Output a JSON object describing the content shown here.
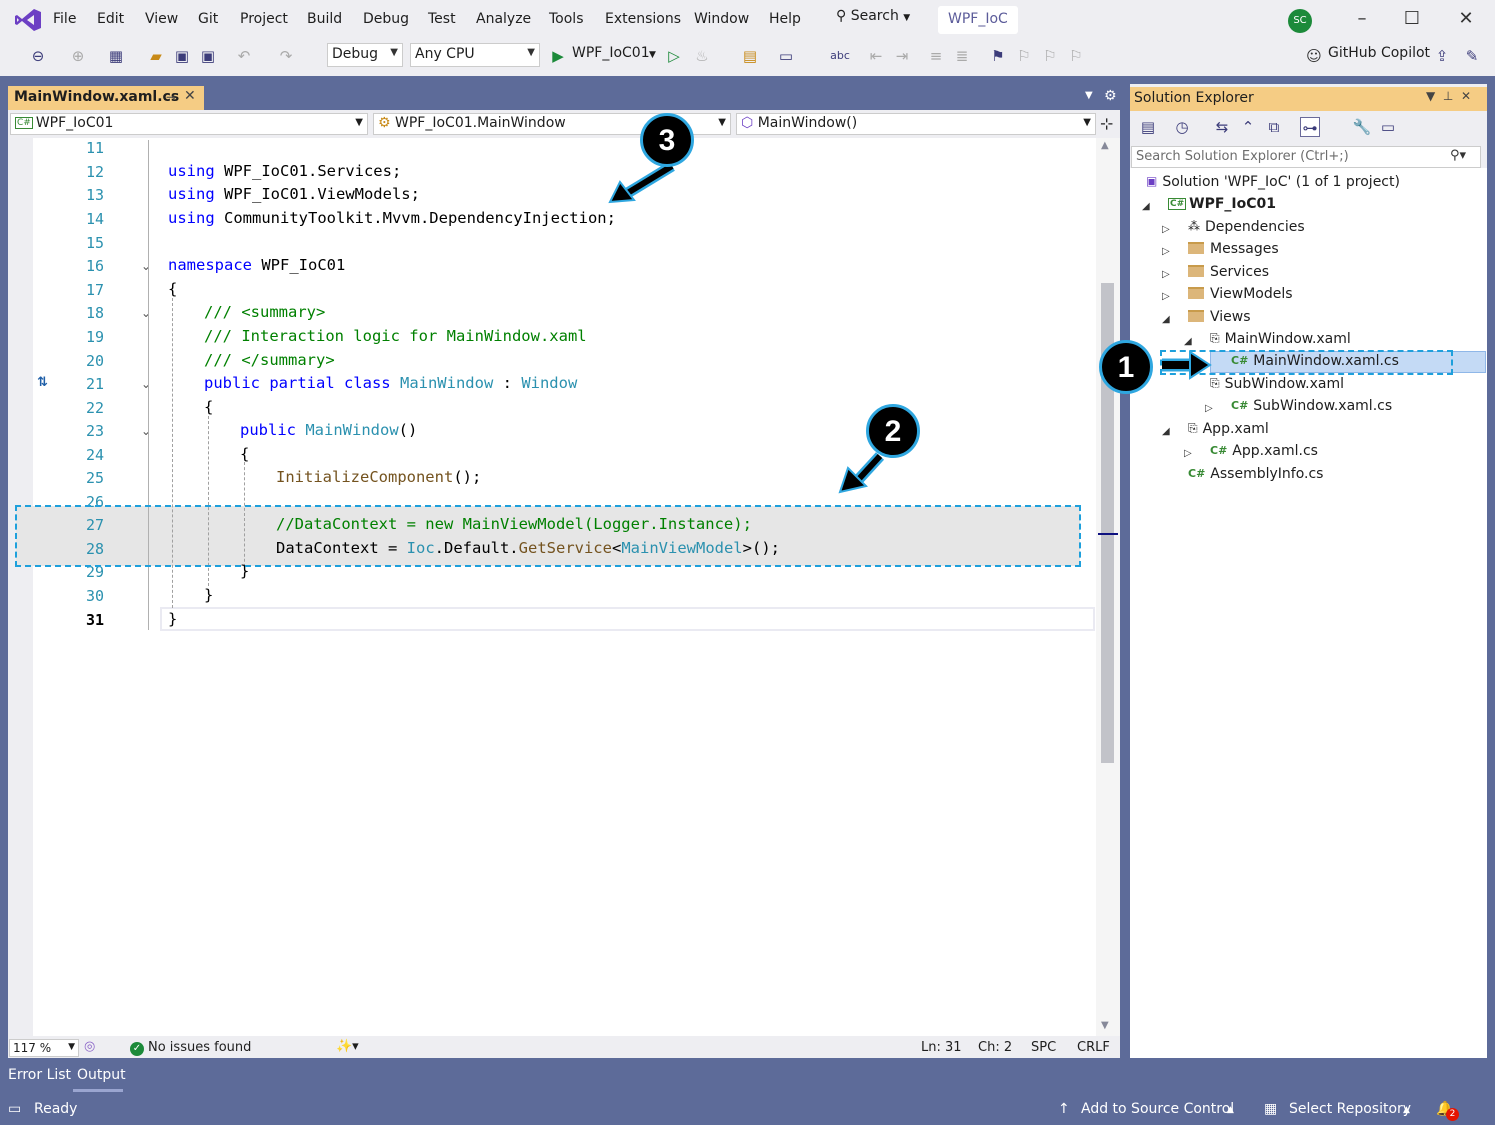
{
  "menu": {
    "items": [
      "File",
      "Edit",
      "View",
      "Git",
      "Project",
      "Build",
      "Debug",
      "Test",
      "Analyze",
      "Tools",
      "Extensions",
      "Window",
      "Help"
    ],
    "search_label": "Search",
    "solution_name": "WPF_IoC",
    "avatar_initials": "SC"
  },
  "toolbar": {
    "configuration": "Debug",
    "platform": "Any CPU",
    "run_target": "WPF_IoC01",
    "copilot_label": "GitHub Copilot"
  },
  "document": {
    "tab_label": "MainWindow.xaml.cs",
    "nav_project": "WPF_IoC01",
    "nav_class": "WPF_IoC01.MainWindow",
    "nav_member": "MainWindow()"
  },
  "editor": {
    "line_numbers": [
      "11",
      "12",
      "13",
      "14",
      "15",
      "16",
      "17",
      "18",
      "19",
      "20",
      "21",
      "22",
      "23",
      "24",
      "25",
      "26",
      "27",
      "28",
      "29",
      "30",
      "31"
    ],
    "lines": {
      "l12_kw": "using",
      "l12_rest": " WPF_IoC01.Services;",
      "l13_kw": "using",
      "l13_rest": " WPF_IoC01.ViewModels;",
      "l14_kw": "using",
      "l14_rest": " CommunityToolkit.Mvvm.DependencyInjection;",
      "l16_kw": "namespace",
      "l16_rest": " WPF_IoC01",
      "l17": "{",
      "l18": "/// <summary>",
      "l19": "/// Interaction logic for MainWindow.xaml",
      "l20": "/// </summary>",
      "l21_kw": "public partial class",
      "l21_type": "MainWindow",
      "l21_colon": " : ",
      "l21_base": "Window",
      "l22": "{",
      "l23_kw": "public",
      "l23_type": "MainWindow",
      "l23_rest": "()",
      "l24": "{",
      "l25_fn": "InitializeComponent",
      "l25_rest": "();",
      "l27": "//DataContext = new MainViewModel(Logger.Instance);",
      "l28_a": "DataContext = ",
      "l28_ty": "Ioc",
      "l28_b": ".Default.",
      "l28_fn": "GetService",
      "l28_c": "<",
      "l28_ty2": "MainViewModel",
      "l28_d": ">();",
      "l29": "}",
      "l30": "}",
      "l31": "}"
    }
  },
  "editor_status": {
    "zoom": "117 %",
    "issues": "No issues found",
    "line": "Ln: 31",
    "col": "Ch: 2",
    "spc": "SPC",
    "eol": "CRLF"
  },
  "bottom_tabs": [
    "Error List",
    "Output"
  ],
  "statusbar": {
    "ready": "Ready",
    "source_control": "Add to Source Control",
    "repository": "Select Repository",
    "notifications_count": "2"
  },
  "solution_explorer": {
    "title": "Solution Explorer",
    "search_placeholder": "Search Solution Explorer (Ctrl+;)",
    "solution": "Solution 'WPF_IoC' (1 of 1 project)",
    "project": "WPF_IoC01",
    "dependencies": "Dependencies",
    "messages": "Messages",
    "services": "Services",
    "viewmodels": "ViewModels",
    "views": "Views",
    "mainwindow_xaml": "MainWindow.xaml",
    "mainwindow_cs": "MainWindow.xaml.cs",
    "subwindow_xaml": "SubWindow.xaml",
    "subwindow_cs": "SubWindow.xaml.cs",
    "app_xaml": "App.xaml",
    "app_cs": "App.xaml.cs",
    "assemblyinfo": "AssemblyInfo.cs"
  },
  "annotations": {
    "one": "1",
    "two": "2",
    "three": "3",
    "color": "#1ea0dc"
  }
}
